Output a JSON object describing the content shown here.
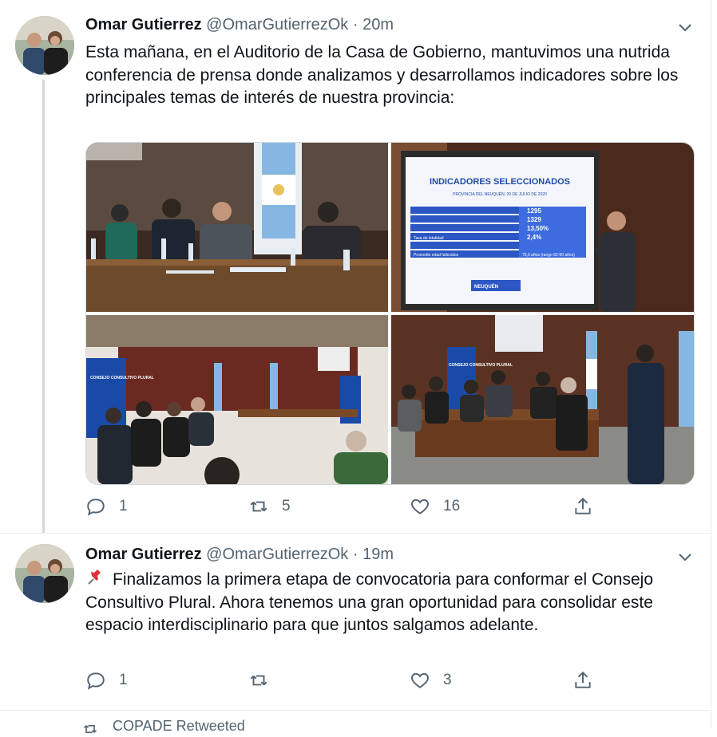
{
  "tweets": [
    {
      "name": "Omar Gutierrez",
      "handle": "@OmarGutierrezOk",
      "separator": "·",
      "time": "20m",
      "text": "Esta mañana, en el Auditorio de la Casa de Gobierno, mantuvimos una nutrida conferencia de prensa donde analizamos y desarrollamos indicadores sobre los principales temas de interés de nuestra provincia:",
      "media": {
        "slide_title": "INDICADORES SELECCIONADOS",
        "slide_subtitle": "PROVINCIA DEL NEUQUÉN, 20 DE JULIO DE 2020",
        "slide_values": [
          "1295",
          "1329",
          "13,50%",
          "2,4%"
        ],
        "slide_row_labels": [
          "Tasa de letalidad",
          "Promedio edad fallecidos"
        ],
        "slide_footer_value": "75,0 años (rango 62-90 años)",
        "slide_logo": "NEUQUÉN",
        "banner_left": "CONSEJO CONSULTIVO PLURAL",
        "banner_right": "CONSEJO CONSULTIVO PLURAL"
      },
      "actions": {
        "reply": "1",
        "retweet": "5",
        "like": "16"
      }
    },
    {
      "name": "Omar Gutierrez",
      "handle": "@OmarGutierrezOk",
      "separator": "·",
      "time": "19m",
      "pin_icon": "pushpin-icon",
      "text": "Finalizamos la primera etapa de convocatoria para conformar el Consejo Consultivo Plural. Ahora tenemos una gran oportunidad para consolidar este espacio interdisciplinario para que juntos salgamos adelante.",
      "actions": {
        "reply": "1",
        "retweet": "",
        "like": "3"
      }
    }
  ],
  "retweeted_banner": "COPADE Retweeted",
  "colors": {
    "text": "#0f1419",
    "secondary": "#536471",
    "border": "#cfd9de"
  }
}
